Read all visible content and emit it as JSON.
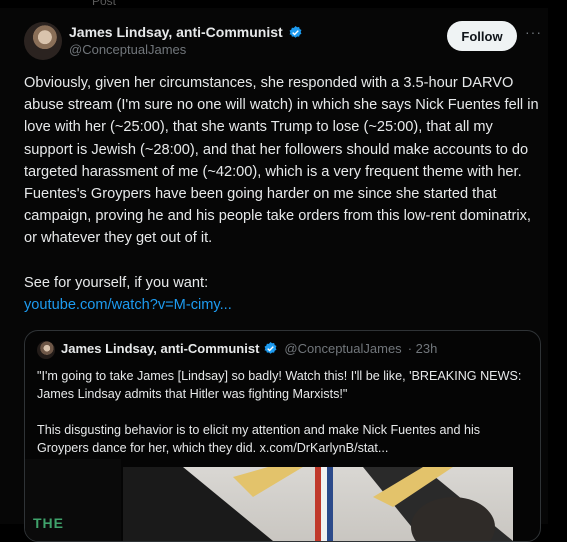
{
  "top_text": "Post",
  "post": {
    "author_name": "James Lindsay, anti-Communist",
    "author_handle": "@ConceptualJames",
    "follow_label": "Follow",
    "more_label": "···",
    "text_p1": "Obviously, given her circumstances, she responded with a 3.5-hour DARVO abuse stream (I'm sure no one will watch) in which she says Nick Fuentes fell in love with her (~25:00), that she wants Trump to lose (~25:00), that all my support is Jewish (~28:00), and that her followers should make accounts to do targeted harassment of me (~42:00), which is a very frequent theme with her. Fuentes's Groypers have been going harder on me since she started that campaign, proving he and his people take orders from this low-rent dominatrix, or whatever they get out of it.",
    "text_p2": "See for yourself, if you want:",
    "link": "youtube.com/watch?v=M-cimy..."
  },
  "quote": {
    "author_name": "James Lindsay, anti-Communist",
    "author_handle": "@ConceptualJames",
    "time": "· 23h",
    "text_p1": "\"I'm going to take James [Lindsay] so badly! Watch this! I'll be like, 'BREAKING NEWS: James Lindsay admits that Hitler was fighting Marxists!\"",
    "text_p2": "This disgusting behavior is to elicit my attention and make Nick Fuentes and his Groypers dance for her, which they did. x.com/DrKarlynB/stat...",
    "media_text": "THE"
  },
  "colors": {
    "accent": "#1d9bf0",
    "verified": "#1d9bf0",
    "background": "#000000"
  }
}
